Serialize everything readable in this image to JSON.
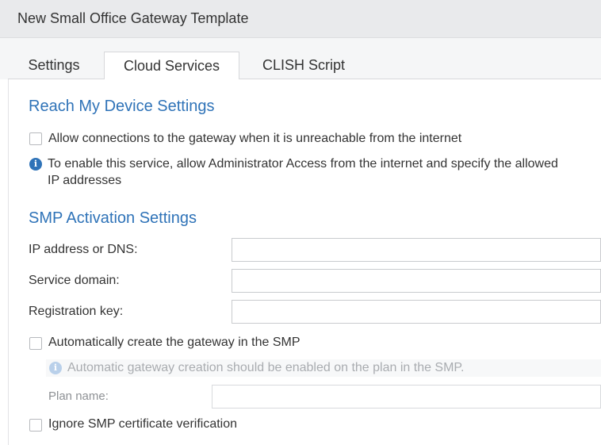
{
  "header": {
    "title": "New Small Office Gateway Template"
  },
  "tabs": [
    {
      "label": "Settings",
      "active": false
    },
    {
      "label": "Cloud Services",
      "active": true
    },
    {
      "label": "CLISH Script",
      "active": false
    }
  ],
  "reach": {
    "title": "Reach My Device Settings",
    "allow_label": "Allow connections to the gateway when it is unreachable from the internet",
    "allow_checked": false,
    "info_line1": "To enable this service, allow Administrator Access from the internet and specify the allowed",
    "info_line2": "IP addresses"
  },
  "smp": {
    "title": "SMP Activation Settings",
    "ip_label": "IP address or DNS:",
    "ip_value": "",
    "domain_label": "Service domain:",
    "domain_value": "",
    "key_label": "Registration key:",
    "key_value": "",
    "auto_create_label": "Automatically create the gateway in the SMP",
    "auto_create_checked": false,
    "auto_note": "Automatic gateway creation should be enabled on the plan in the SMP.",
    "plan_label": "Plan name:",
    "plan_value": "",
    "ignore_cert_label": "Ignore SMP certificate verification",
    "ignore_cert_checked": false
  },
  "colors": {
    "accent": "#2f73b8",
    "header_bg": "#e9eaec",
    "muted_text": "#a9acb0"
  },
  "icons": {
    "info": "info-circle-icon",
    "checkbox": "checkbox-unchecked-icon"
  }
}
